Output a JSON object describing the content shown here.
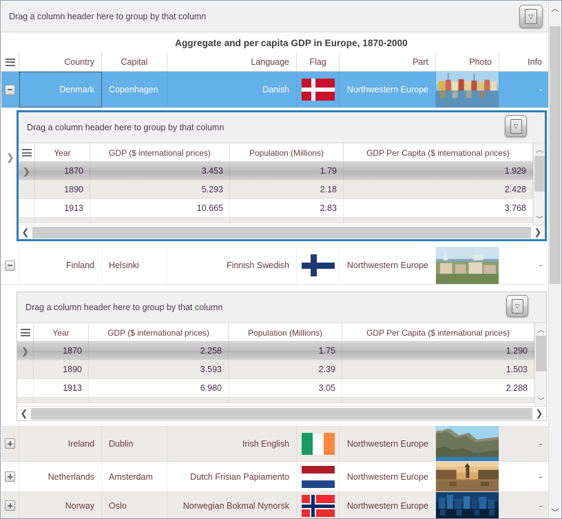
{
  "window": {
    "group_panel_text": "Drag a column header here to group by that column",
    "filter_button_icon": "filter-funnel-icon",
    "grid_title": "Aggregate and per capita GDP in Europe, 1870-2000"
  },
  "master_grid": {
    "menu_icon": "hamburger-menu-icon",
    "columns": [
      {
        "label": "Country",
        "align": "right"
      },
      {
        "label": "Capital",
        "align": "left"
      },
      {
        "label": "Language",
        "align": "right"
      },
      {
        "label": "Flag",
        "align": "center"
      },
      {
        "label": "Part",
        "align": "right"
      },
      {
        "label": "Photo",
        "align": "right"
      },
      {
        "label": "Info",
        "align": "right"
      }
    ],
    "rows": [
      {
        "country": "Denmark",
        "capital": "Copenhagen",
        "language": "Danish",
        "flag": "flag-denmark",
        "part": "Northwestern Europe",
        "photo": "photo-denmark-harbor",
        "info": "-",
        "expanded": true,
        "selected": true,
        "focused": true
      },
      {
        "country": "Finland",
        "capital": "Helsinki",
        "language": "Finnish Swedish",
        "flag": "flag-finland",
        "part": "Northwestern Europe",
        "photo": "photo-finland-helsinki",
        "info": "-",
        "expanded": true,
        "selected": false,
        "focused": false
      },
      {
        "country": "Ireland",
        "capital": "Dublin",
        "language": "Irish English",
        "flag": "flag-ireland",
        "part": "Northwestern Europe",
        "photo": "photo-ireland-cliffs",
        "info": "-",
        "expanded": false,
        "selected": false,
        "focused": false
      },
      {
        "country": "Netherlands",
        "capital": "Amsterdam",
        "language": "Dutch Frisian Papiamento",
        "flag": "flag-netherlands",
        "part": "Northwestern Europe",
        "photo": "photo-netherlands-canal",
        "info": "-",
        "expanded": false,
        "selected": false,
        "focused": false
      },
      {
        "country": "Norway",
        "capital": "Oslo",
        "language": "Norwegian Bokmal Nynorsk",
        "flag": "flag-norway",
        "part": "Northwestern Europe",
        "photo": "photo-norway-oslo",
        "info": "-",
        "expanded": false,
        "selected": false,
        "focused": false
      }
    ]
  },
  "detail_grids": [
    {
      "owner": "Denmark",
      "group_panel_text": "Drag a column header here to group by that column",
      "filter_button_icon": "filter-funnel-icon",
      "menu_icon": "hamburger-menu-icon",
      "columns": [
        "Year",
        "GDP ($ international prices)",
        "Population (Millions)",
        "GDP Per Capita ($ international prices)"
      ],
      "rows": [
        {
          "year": "1870",
          "gdp": "3.453",
          "population": "1.79",
          "gdp_per_capita": "1.929",
          "selected": true
        },
        {
          "year": "1890",
          "gdp": "5.293",
          "population": "2.18",
          "gdp_per_capita": "2.428",
          "selected": false
        },
        {
          "year": "1913",
          "gdp": "10.665",
          "population": "2.83",
          "gdp_per_capita": "3.768",
          "selected": false
        }
      ]
    },
    {
      "owner": "Finland",
      "group_panel_text": "Drag a column header here to group by that column",
      "filter_button_icon": "filter-funnel-icon",
      "menu_icon": "hamburger-menu-icon",
      "columns": [
        "Year",
        "GDP ($ international prices)",
        "Population (Millions)",
        "GDP Per Capita ($ international prices)"
      ],
      "rows": [
        {
          "year": "1870",
          "gdp": "2.258",
          "population": "1.75",
          "gdp_per_capita": "1.290",
          "selected": true
        },
        {
          "year": "1890",
          "gdp": "3.593",
          "population": "2.39",
          "gdp_per_capita": "1.503",
          "selected": false
        },
        {
          "year": "1913",
          "gdp": "6.980",
          "population": "3.05",
          "gdp_per_capita": "2.288",
          "selected": false
        }
      ]
    }
  ],
  "scrollbars": {
    "main_vertical": {
      "up_arrow": "chevron-up-icon",
      "down_arrow": "chevron-down-icon"
    },
    "detail_vertical": {
      "up_arrow": "chevron-up-icon",
      "down_arrow": "chevron-down-icon"
    },
    "detail_horizontal": {
      "left_arrow": "chevron-left-icon",
      "right_arrow": "chevron-right-icon"
    }
  },
  "colors": {
    "selection_blue": "#64b0e8",
    "focus_border": "#2a7fb8",
    "alt_row": "#eceae7",
    "text": "#6b3a3f",
    "panel": "#f0f0f0"
  }
}
